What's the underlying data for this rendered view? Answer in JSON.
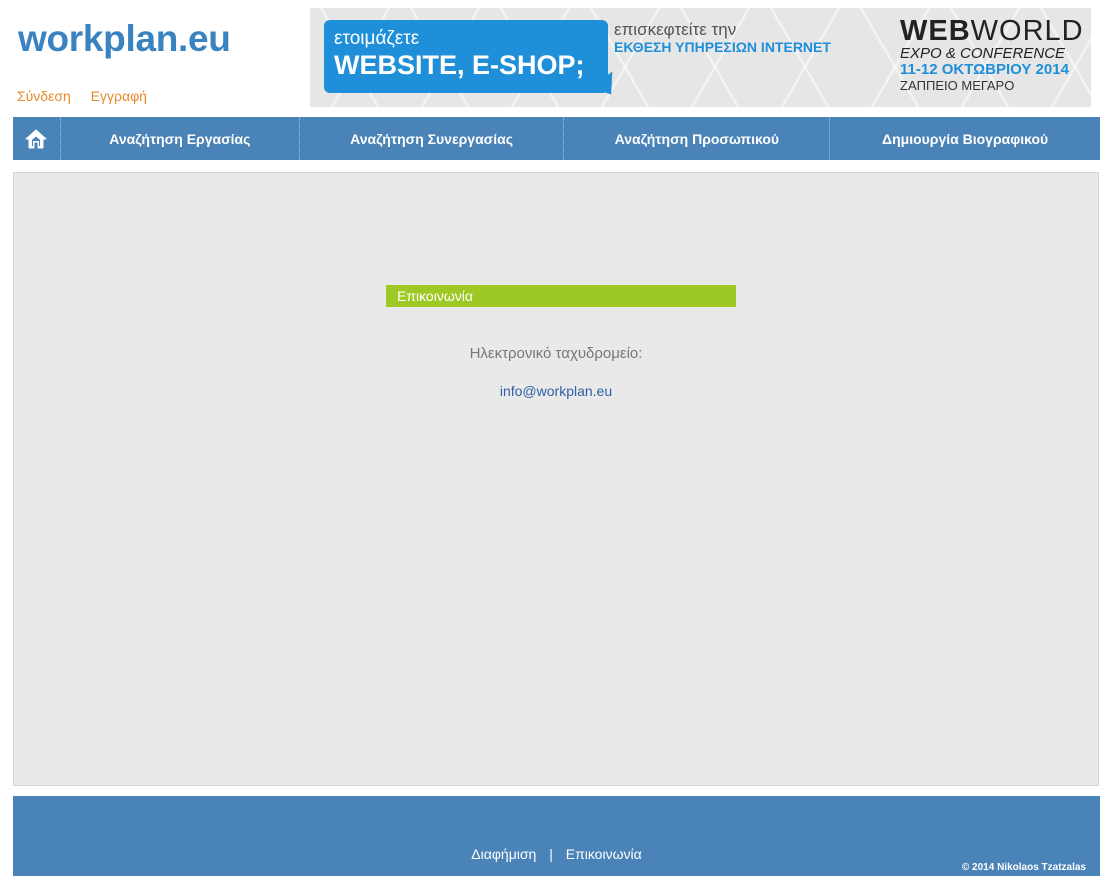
{
  "site": {
    "logo": "workplan.eu"
  },
  "auth": {
    "login": "Σύνδεση",
    "register": "Εγγραφή"
  },
  "banner": {
    "bubble_line1": "ετοιμάζετε",
    "bubble_line2": "WEBSITE, E-SHOP;",
    "visit_line1": "επισκεφτείτε την",
    "visit_line2": "ΕΚΘΕΣΗ ΥΠΗΡΕΣΙΩΝ INTERNET",
    "brand_web": "WEB",
    "brand_world": "WORLD",
    "expo": "EXPO & CONFERENCE",
    "dates": "11-12 ΟΚΤΩΒΡΙΟΥ 2014",
    "venue": "ΖΑΠΠΕΙΟ ΜΕΓΑΡΟ"
  },
  "nav": {
    "items": [
      {
        "label": "Αναζήτηση Εργασίας"
      },
      {
        "label": "Αναζήτηση Συνεργασίας"
      },
      {
        "label": "Αναζήτηση Προσωπικού"
      },
      {
        "label": "Δημιουργία Βιογραφικού"
      }
    ]
  },
  "contact": {
    "heading": "Επικοινωνία",
    "email_label": "Ηλεκτρονικό ταχυδρομείο:",
    "email": "info@workplan.eu"
  },
  "footer": {
    "advertising": "Διαφήμιση",
    "separator": "|",
    "contact": "Επικοινωνία",
    "copyright": "© 2014 Nikolaos Tzatzalas"
  },
  "colors": {
    "brand_blue": "#3a83c1",
    "nav_blue": "#4a83b7",
    "accent_orange": "#e8892b",
    "heading_green": "#9ec823",
    "link_blue": "#2f5fa6"
  }
}
